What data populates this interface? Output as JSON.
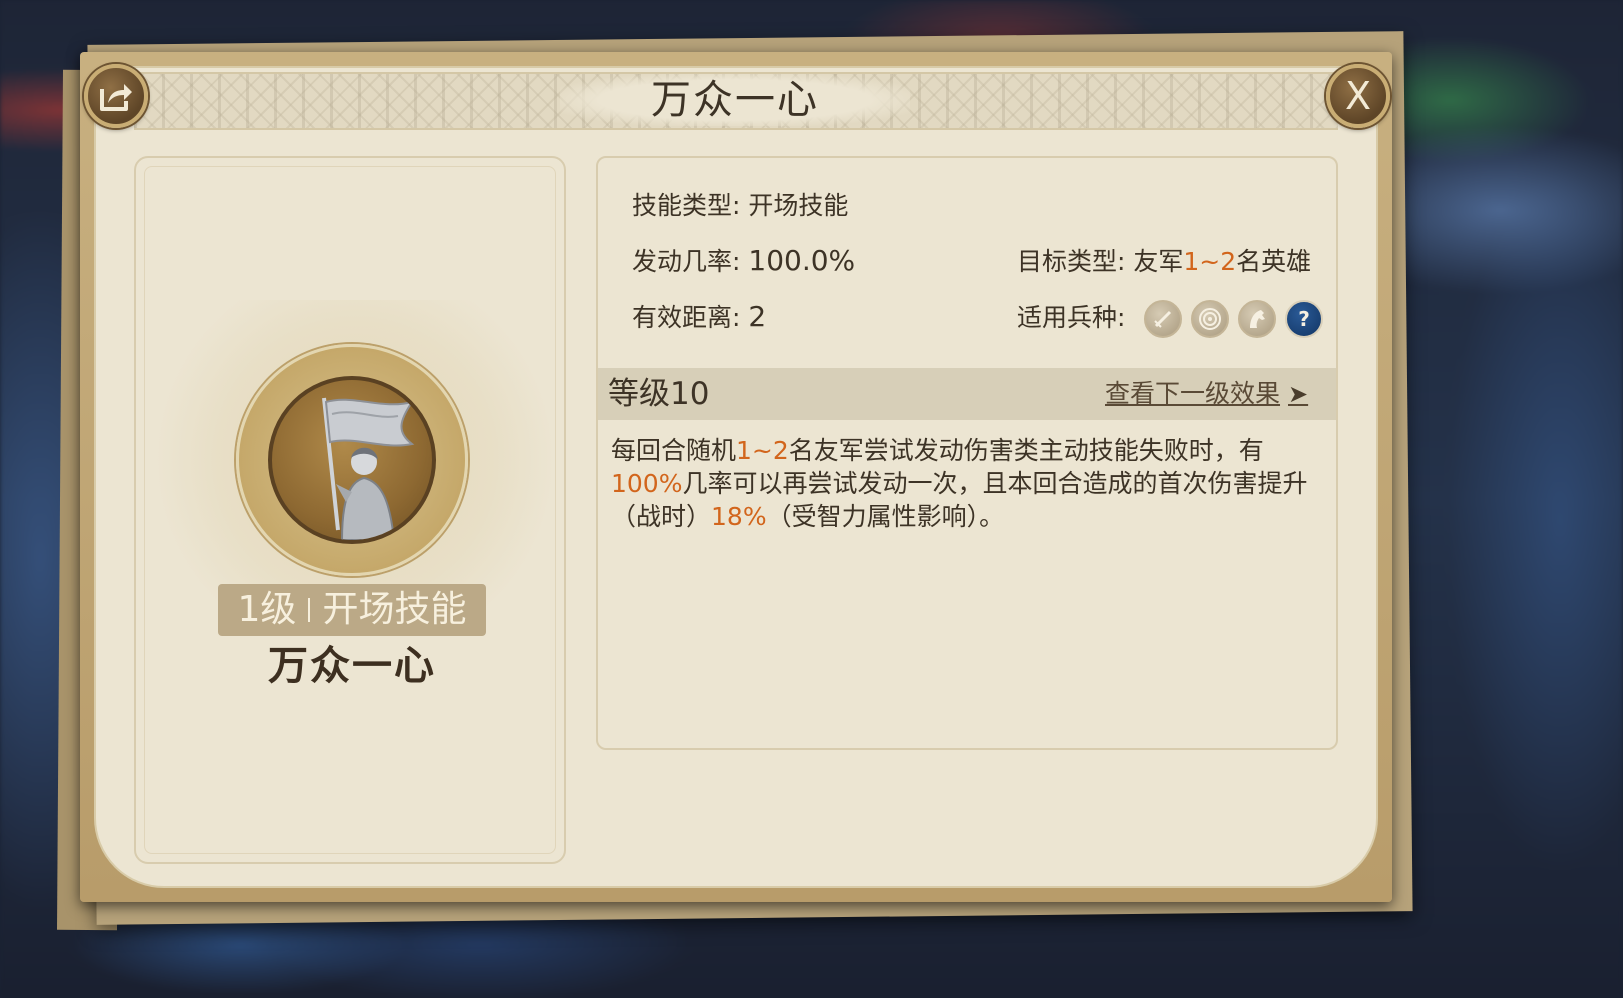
{
  "dialog": {
    "title": "万众一心",
    "close_glyph": "X"
  },
  "left": {
    "level_text": "1级",
    "type_text": "开场技能",
    "skill_name": "万众一心"
  },
  "info": {
    "skill_type_label": "技能类型:",
    "skill_type_value": "开场技能",
    "rate_label": "发动几率:",
    "rate_value": "100.0%",
    "target_label": "目标类型:",
    "target_prefix": "友军",
    "target_count": "1~2",
    "target_suffix": "名英雄",
    "range_label": "有效距离:",
    "range_value": "2",
    "troop_label": "适用兵种:",
    "troop_icons": [
      "sword-icon",
      "target-icon",
      "horse-icon",
      "question-icon"
    ],
    "help_glyph": "?"
  },
  "level_section": {
    "level": "等级10",
    "next_link": "查看下一级效果",
    "arrow": "➤"
  },
  "description": {
    "p1": "每回合随机",
    "v1": "1~2",
    "p2": "名友军尝试发动伤害类主动技能失败时，有",
    "v2": "100%",
    "p3": "几率可以再尝试发动一次，且本回合造成的首次伤害提升（战时）",
    "v3": "18%",
    "p4": "（受智力属性影响）。"
  },
  "colors": {
    "highlight": "#d2651c",
    "text": "#3d3326",
    "paper": "#ece5d2",
    "frame": "#c8b080"
  }
}
